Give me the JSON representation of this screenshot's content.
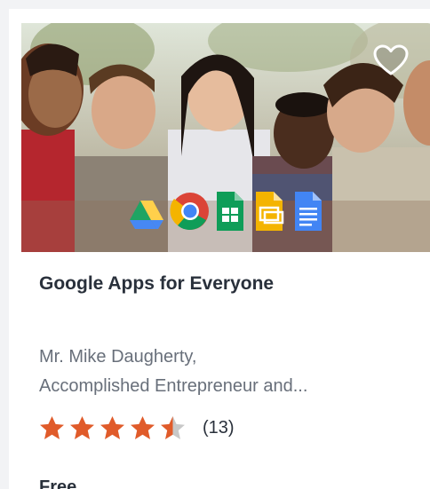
{
  "course": {
    "title": "Google Apps for Everyone",
    "author_line1": "Mr. Mike Daugherty,",
    "author_line2": "Accomplished Entrepreneur and...",
    "rating_value": 4.5,
    "rating_count": "(13)",
    "price": "Free"
  },
  "hero": {
    "icons": [
      "google-drive-icon",
      "chrome-icon",
      "google-sheets-icon",
      "google-slides-icon",
      "google-docs-icon"
    ]
  },
  "colors": {
    "star": "#e05b2a",
    "star_empty": "#c8c8c8",
    "title": "#29303b",
    "author": "#686f7a"
  }
}
